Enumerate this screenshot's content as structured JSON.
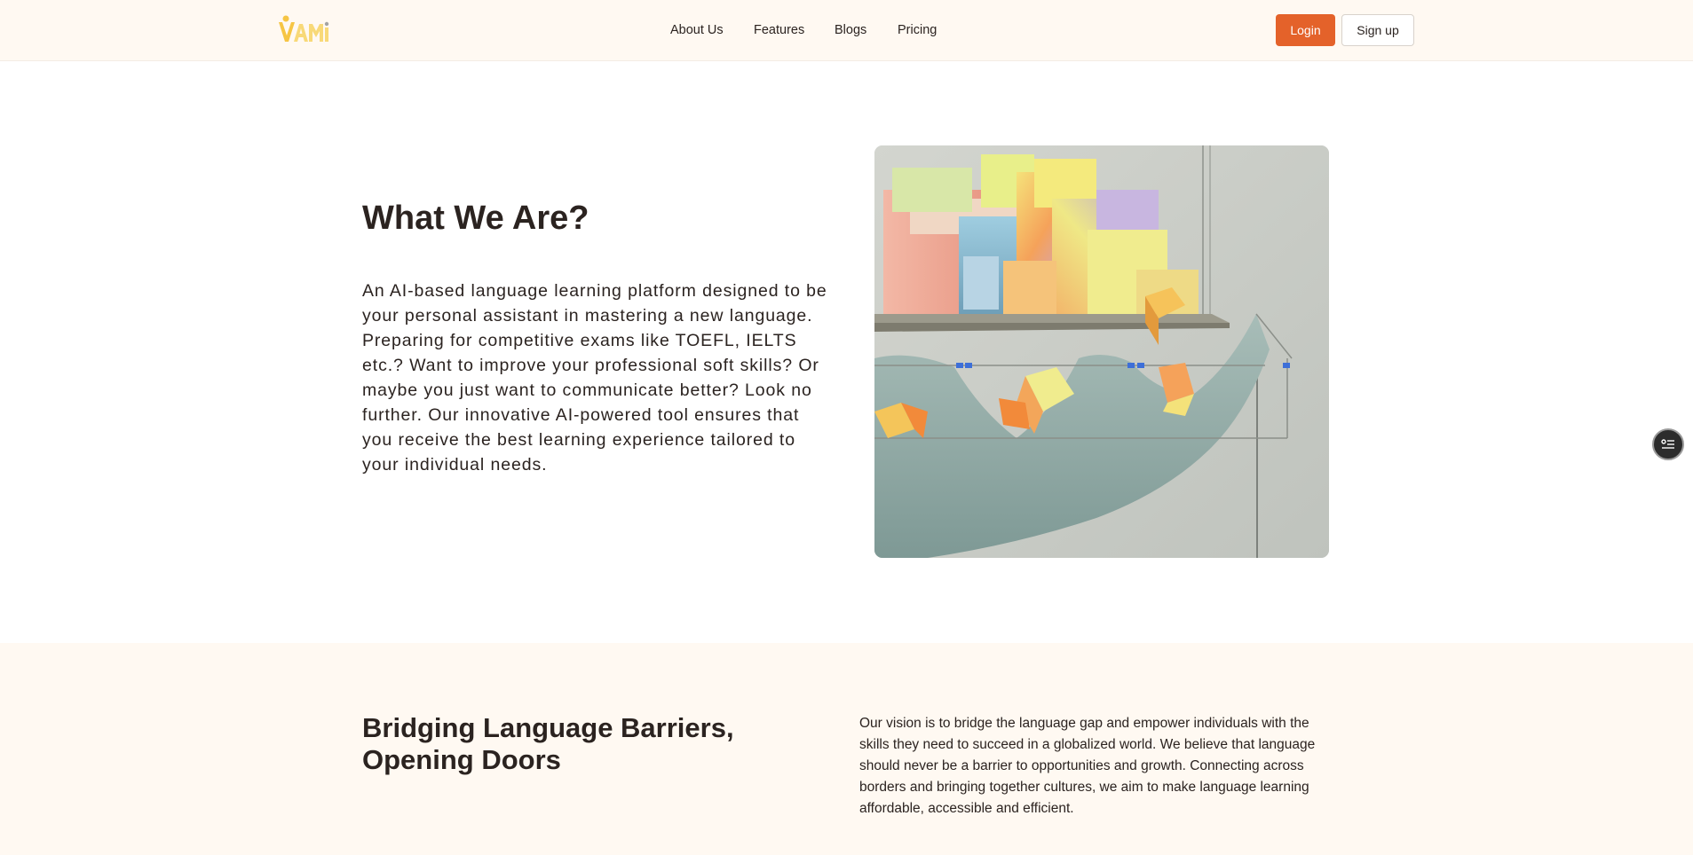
{
  "header": {
    "logo_text": "VAMI",
    "nav": [
      {
        "label": "About Us"
      },
      {
        "label": "Features"
      },
      {
        "label": "Blogs"
      },
      {
        "label": "Pricing"
      }
    ],
    "login_label": "Login",
    "signup_label": "Sign up",
    "accent_color": "#e4622a",
    "header_bg": "#fff9f2"
  },
  "what": {
    "title": "What We Are?",
    "body": "An AI-based language learning platform designed to be your personal assistant in mastering a new language. Preparing for competitive exams like TOEFL, IELTS etc.? Want to improve your professional soft skills? Or maybe you just want to communicate better? Look no further. Our innovative AI-powered tool ensures that you receive the best learning experience tailored to your individual needs.",
    "image_icon": "abstract-3d-blocks-image"
  },
  "vision": {
    "title": "Bridging Language Barriers, Opening Doors",
    "body": "Our vision is to bridge the language gap and empower individuals with the skills they need to succeed in a globalized world. We believe that language should never be a barrier to opportunities and growth. Connecting across borders and bringing together cultures, we aim to make language learning affordable, accessible and efficient."
  },
  "widget": {
    "icon": "list-settings-icon"
  }
}
